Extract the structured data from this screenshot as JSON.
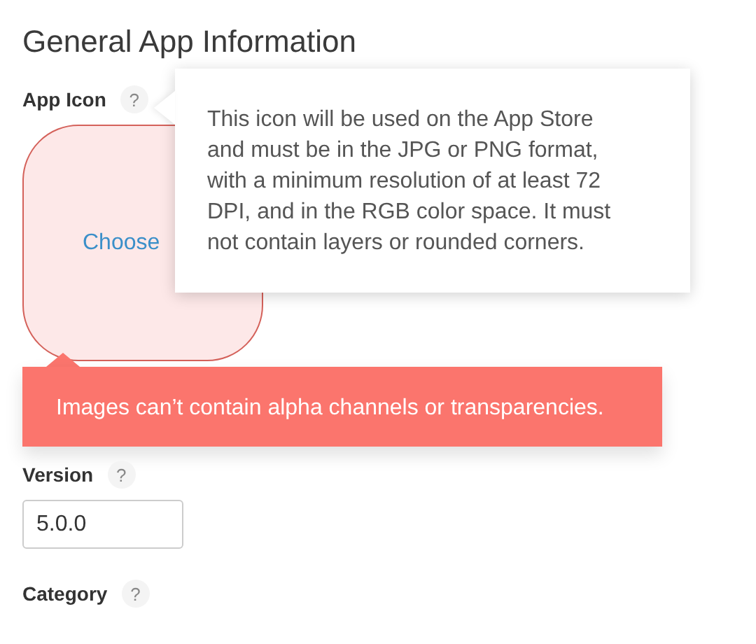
{
  "title": "General App Information",
  "fields": [
    {
      "kind": "image",
      "label": "App Icon",
      "help": "?",
      "action": "Choose",
      "invalid": true,
      "tooltip": "This icon will be used on the App Store and must be in the JPG or PNG format, with a minimum resolution of at least 72 DPI, and in the RGB color space. It must not contain layers or rounded corners.",
      "error": "Images can’t contain alpha channels or transparencies."
    },
    {
      "kind": "text",
      "label": "Version",
      "help": "?",
      "value": "5.0.0"
    },
    {
      "kind": "label",
      "label": "Category",
      "help": "?"
    }
  ]
}
